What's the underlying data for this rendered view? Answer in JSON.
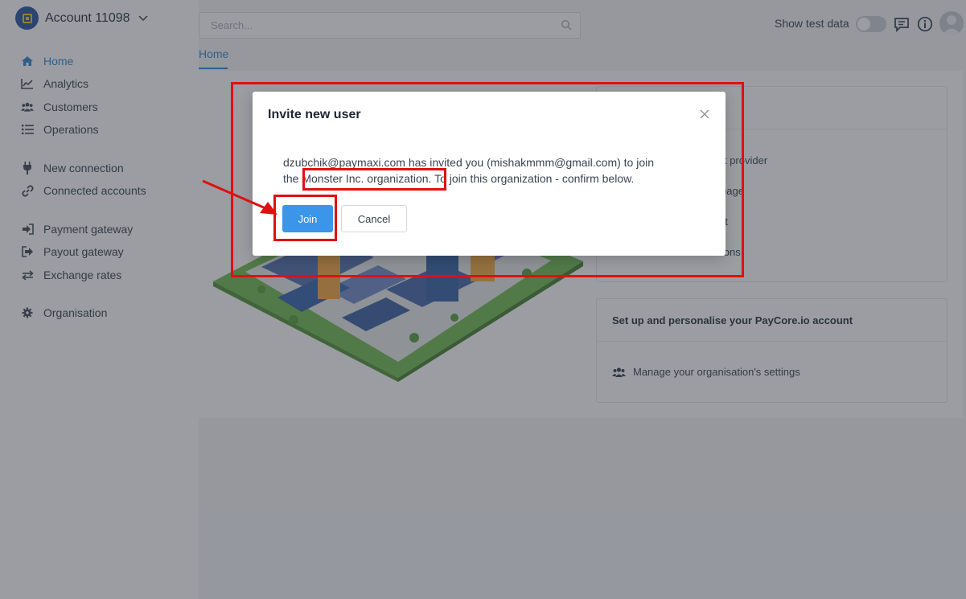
{
  "account": {
    "name": "Account 11098"
  },
  "sidebar": {
    "items": [
      {
        "label": "Home",
        "icon": "home-icon"
      },
      {
        "label": "Analytics",
        "icon": "chart-line-icon"
      },
      {
        "label": "Customers",
        "icon": "users-icon"
      },
      {
        "label": "Operations",
        "icon": "list-icon"
      },
      {
        "label": "New connection",
        "icon": "plug-icon"
      },
      {
        "label": "Connected accounts",
        "icon": "link-icon"
      },
      {
        "label": "Payment gateway",
        "icon": "sign-in-icon"
      },
      {
        "label": "Payout gateway",
        "icon": "sign-out-icon"
      },
      {
        "label": "Exchange rates",
        "icon": "exchange-icon"
      },
      {
        "label": "Organisation",
        "icon": "gear-icon"
      }
    ]
  },
  "header": {
    "search_placeholder": "Search...",
    "toggle_label": "Show test data",
    "toggle_on": false
  },
  "breadcrumb": {
    "tab": "Home"
  },
  "main": {
    "card1_items_visible": [
      "t provider",
      "page",
      "nt",
      "ations"
    ],
    "card2": {
      "title": "Set up and personalise your PayCore.io account",
      "item": "Manage your organisation's settings"
    }
  },
  "modal": {
    "title": "Invite new user",
    "text_line1": "dzubchik@paymaxi.com has invited you (mishakmmm@gmail.com) to join",
    "text_line2_prefix": "the ",
    "org_name": "Monster Inc. organization.",
    "text_line2_suffix": " To join this organization - confirm below.",
    "join_label": "Join",
    "cancel_label": "Cancel"
  },
  "colors": {
    "accent": "#2f7fc9",
    "button_primary": "#3b95e8",
    "annotation": "#e01010"
  }
}
